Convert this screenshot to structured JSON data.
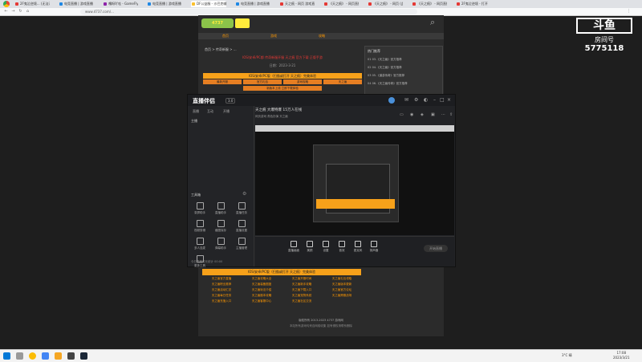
{
  "browser": {
    "tabs": [
      {
        "label": "2F鬼泣逆境... (无法清晰读取)",
        "color": "#e53935"
      },
      {
        "label": "电竞直播 | 游戏直播",
        "color": "#1e88e5"
      },
      {
        "label": "嘎呀吖哇 - GameFly.com",
        "color": "#8e24aa"
      },
      {
        "label": "电竞直播 | 游戏直播",
        "color": "#1e88e5"
      },
      {
        "label": "DF公益服 - 沙巴克辅助",
        "color": "#fbc02d"
      },
      {
        "label": "电竞直播 | 游戏直播",
        "color": "#1e88e5"
      },
      {
        "label": "天之痕 - 网页 游戏直播",
        "color": "#e53935"
      },
      {
        "label": "《天之痕》 - 网页直播",
        "color": "#e53935"
      },
      {
        "label": "《天之痕》 - 网页 (此列)",
        "color": "#e53935"
      },
      {
        "label": "《天之痕》 - 网页直播",
        "color": "#e53935"
      },
      {
        "label": "2F鬼泣逆境 - 打开",
        "color": "#e53935"
      }
    ],
    "url": "www.4737.com/..."
  },
  "webpage": {
    "logo": "4737",
    "nav": [
      "首页",
      "游戏",
      "攻略"
    ],
    "breadcrumb": "首页 > 传奇新服 > ...",
    "headline": "IOS/安卓/PC都 传奇新服开服 天之痕 官方下载 正版手游",
    "meta": "日期：2023-3-21",
    "orange_banner": "IOS/安卓/PC版（扫描或打开 天之痕）完美体验",
    "orange_buttons": [
      "最新开服",
      "官方礼包",
      "游戏攻略",
      "天之痕"
    ],
    "orange_wide": "新版本上线 立即下载体验",
    "hot": {
      "title": "热门推荐",
      "items": [
        "01 03.《天之痕》官方推荐",
        "02 04.《天之痕》官方推荐",
        "03 05.《道游传奇》官方推荐",
        "04 06.《天之痕传奇》官方推荐"
      ]
    },
    "lower_banner": "IOS/安卓/PC版（扫描或打开 天之痕）完美体验",
    "lower_list": [
      "天之痕官方直播",
      "天之痕攻略大全",
      "天之痕开服时间",
      "天之痕礼包领取",
      "天之痕职业推荐",
      "天之痕装备图鉴",
      "天之痕新手攻略",
      "天之痕版本更新",
      "天之痕活动汇总",
      "天之痕玩法介绍",
      "天之痕下载入口",
      "天之痕官方论坛",
      "天之痕每日任务",
      "天之痕副本攻略",
      "天之痕宠物系统",
      "天之痕跨服战场",
      "天之痕充值入口",
      "天之痕客服中心",
      "天之痕社区交流"
    ],
    "footer1": "版权所有 2013-2023 4737 游戏网",
    "footer2": "本站所有游戏均来自网络收集 如有侵权请联系删除"
  },
  "watermark": {
    "logo": "斗鱼",
    "label": "房间号",
    "room": "5775118"
  },
  "client": {
    "app_name": "直播伴侣",
    "app_badge": "3.0",
    "side_tabs": [
      "直播",
      "互动",
      "开播"
    ],
    "user": "主播",
    "tools_label": "工具箱",
    "tools": [
      "录屏助手",
      "直播助手",
      "直播任务",
      "视频剪辑",
      "截图保存",
      "直播设置",
      "多人连麦",
      "弹幕助手",
      "主播管理",
      "更多工具"
    ],
    "side_bottom": "今日直播时长统计 00:00",
    "stream_title": "天之痕 大爆特爆 15万人在线",
    "stream_tags": "网页游戏  角色扮演  天之痕",
    "bottom_tools": [
      "直播画面",
      "美颜",
      "设置",
      "音效",
      "麦克风",
      "扬声器"
    ],
    "start_button": "开始直播"
  },
  "taskbar": {
    "temp": "3°C 晴",
    "time": "17:08",
    "date": "2023/3/21"
  }
}
